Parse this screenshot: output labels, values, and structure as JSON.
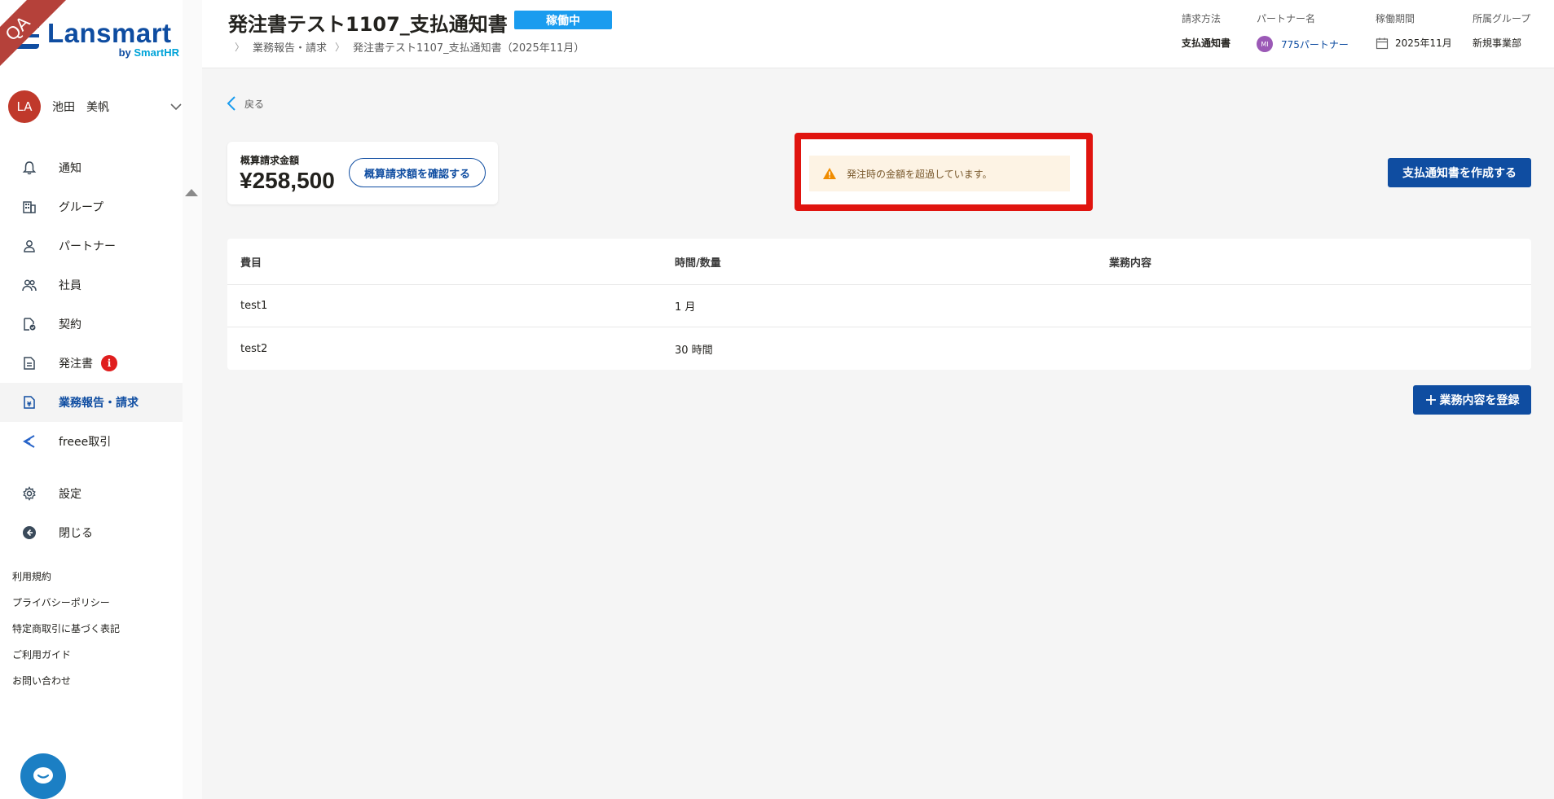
{
  "badge_qa": "QA",
  "brand": {
    "name": "Lansmart",
    "by": "by ",
    "partner": "SmartHR"
  },
  "user": {
    "initials": "LA",
    "name": "池田　美帆"
  },
  "nav": [
    {
      "label": "通知",
      "icon": "bell-icon"
    },
    {
      "label": "グループ",
      "icon": "building-icon"
    },
    {
      "label": "パートナー",
      "icon": "person-icon"
    },
    {
      "label": "社員",
      "icon": "people-icon"
    },
    {
      "label": "契約",
      "icon": "contract-icon"
    },
    {
      "label": "発注書",
      "icon": "document-icon",
      "badge": "i"
    },
    {
      "label": "業務報告・請求",
      "icon": "invoice-icon",
      "active": true
    },
    {
      "label": "freee取引",
      "icon": "freee-icon"
    },
    {
      "label": "設定",
      "icon": "gear-icon"
    },
    {
      "label": "閉じる",
      "icon": "collapse-icon"
    }
  ],
  "footer_links": [
    "利用規約",
    "プライバシーポリシー",
    "特定商取引に基づく表記",
    "ご利用ガイド",
    "お問い合わせ"
  ],
  "header": {
    "title": "発注書テスト1107_支払通知書",
    "status": "稼働中",
    "breadcrumb": [
      "業務報告・請求",
      "発注書テスト1107_支払通知書（2025年11月）"
    ],
    "meta": [
      {
        "label": "請求方法",
        "value": "支払通知書"
      },
      {
        "label": "パートナー名",
        "value": "775パートナー",
        "avatar": "MI"
      },
      {
        "label": "稼働期間",
        "value": "2025年11月"
      },
      {
        "label": "所属グループ",
        "value": "新規事業部"
      }
    ]
  },
  "back_label": "戻る",
  "summary": {
    "label": "概算請求金額",
    "amount": "¥258,500",
    "confirm_button": "概算請求額を確認する"
  },
  "warning": "発注時の金額を超過しています。",
  "create_button": "支払通知書を作成する",
  "table": {
    "headers": [
      "費目",
      "時間/数量",
      "業務内容"
    ],
    "rows": [
      [
        "test1",
        "1 月",
        ""
      ],
      [
        "test2",
        "30 時間",
        ""
      ]
    ]
  },
  "register_button": "業務内容を登録",
  "register_icon": "plus-icon",
  "colors": {
    "primary": "#0f4da1",
    "status": "#1a9cef",
    "warning_frame": "#e0140f",
    "badge": "#e01e1e"
  }
}
